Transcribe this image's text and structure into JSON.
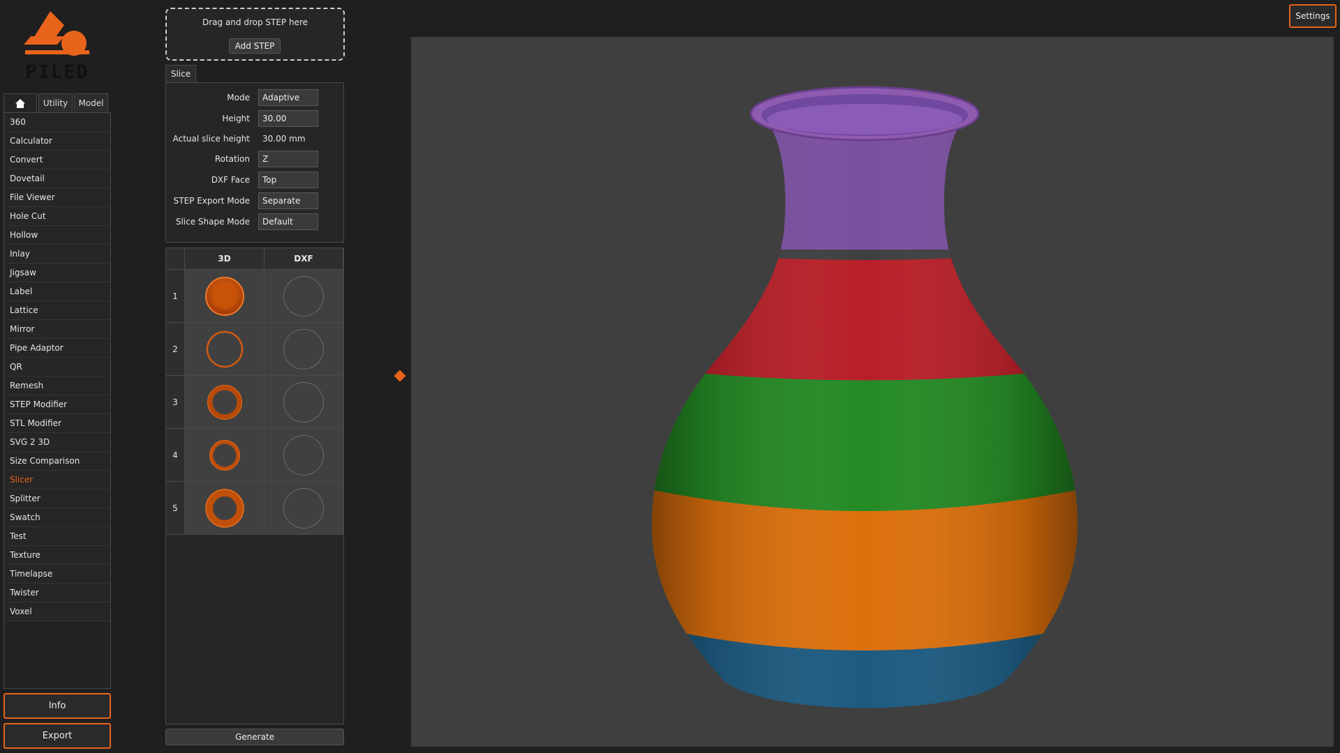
{
  "brand": {
    "logo_text": "PILED",
    "accent": "#e8641b"
  },
  "nav": {
    "tabs": [
      {
        "label": ""
      },
      {
        "label": "Utility"
      },
      {
        "label": "Model"
      }
    ],
    "tools": [
      "360",
      "Calculator",
      "Convert",
      "Dovetail",
      "File Viewer",
      "Hole Cut",
      "Hollow",
      "Inlay",
      "Jigsaw",
      "Label",
      "Lattice",
      "Mirror",
      "Pipe Adaptor",
      "QR",
      "Remesh",
      "STEP Modifier",
      "STL Modifier",
      "SVG 2 3D",
      "Size Comparison",
      "Slicer",
      "Splitter",
      "Swatch",
      "Test",
      "Texture",
      "Timelapse",
      "Twister",
      "Voxel"
    ],
    "active_tool": "Slicer"
  },
  "buttons": {
    "info": "Info",
    "export": "Export",
    "settings": "Settings",
    "generate": "Generate"
  },
  "dropzone": {
    "text": "Drag and drop STEP here",
    "button": "Add STEP"
  },
  "slice": {
    "tab": "Slice",
    "mode_label": "Mode",
    "mode": "Adaptive",
    "height_label": "Height",
    "height": "30.00",
    "actual_label": "Actual slice height",
    "actual": "30.00 mm",
    "rotation_label": "Rotation",
    "rotation": "Z",
    "dxf_face_label": "DXF Face",
    "dxf_face": "Top",
    "step_export_label": "STEP Export Mode",
    "step_export": "Separate",
    "shape_mode_label": "Slice Shape Mode",
    "shape_mode": "Default"
  },
  "table": {
    "headers": [
      "3D",
      "DXF"
    ],
    "rows": [
      "1",
      "2",
      "3",
      "4",
      "5"
    ]
  },
  "model_colors": [
    "#8e5bb0",
    "#c0262c",
    "#2a8e2a",
    "#e07a12",
    "#1f5f86"
  ]
}
